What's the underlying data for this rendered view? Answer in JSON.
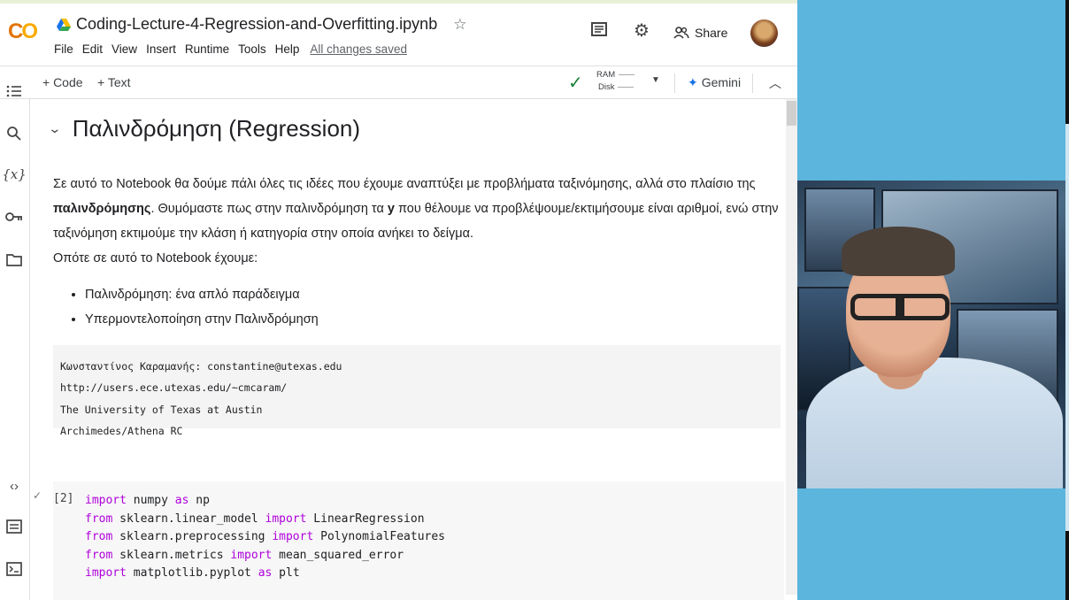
{
  "header": {
    "notebook_name": "Coding-Lecture-4-Regression-and-Overfitting.ipynb",
    "menu": [
      "File",
      "Edit",
      "View",
      "Insert",
      "Runtime",
      "Tools",
      "Help"
    ],
    "save_status": "All changes saved",
    "share_label": "Share"
  },
  "toolbar": {
    "add_code": "+ Code",
    "add_text": "+ Text",
    "ram_label": "RAM",
    "disk_label": "Disk",
    "gemini_label": "Gemini"
  },
  "notebook": {
    "heading": "Παλινδρόμηση (Regression)",
    "para_before_bold": "Σε αυτό το Notebook θα δούμε πάλι όλες τις ιδέες που έχουμε αναπτύξει με προβλήματα ταξινόμησης, αλλά στο πλαίσιο της ",
    "para_bold": "παλινδρόμησης",
    "para_mid": ". Θυμόμαστε πως στην παλινδρόμηση τα ",
    "para_bold2": "y",
    "para_after": " που θέλουμε να προβλέψουμε/εκτιμήσουμε είναι αριθμοί, ενώ στην ταξινόμηση εκτιμούμε την κλάση ή κατηγορία στην οποία ανήκει το δείγμα.",
    "para2": "Οπότε σε αυτό το Notebook έχουμε:",
    "bullets": [
      "Παλινδρόμηση: ένα απλό παράδειγμα",
      "Υπερμοντελοποίηση στην Παλινδρόμηση"
    ],
    "info_lines": [
      "Κωνσταντίνος Καραμανής: constantine@utexas.edu",
      "http://users.ece.utexas.edu/~cmcaram/",
      "The University of Texas at Austin",
      "Archimedes/Athena RC"
    ],
    "exec_count": "[2]",
    "code_lines": [
      {
        "kw1": "import",
        "a": " numpy ",
        "kw2": "as",
        "b": " np"
      },
      {
        "kw1": "from",
        "a": " sklearn.linear_model ",
        "kw2": "import",
        "b": " LinearRegression"
      },
      {
        "kw1": "from",
        "a": " sklearn.preprocessing ",
        "kw2": "import",
        "b": " PolynomialFeatures"
      },
      {
        "kw1": "from",
        "a": " sklearn.metrics ",
        "kw2": "import",
        "b": " mean_squared_error"
      },
      {
        "kw1": "import",
        "a": " matplotlib.pyplot ",
        "kw2": "as",
        "b": " plt"
      }
    ]
  },
  "colors": {
    "accent_blue": "#1a73e8",
    "keyword_purple": "#af00db",
    "check_green": "#188038",
    "background_blue": "#5bb5dc"
  }
}
